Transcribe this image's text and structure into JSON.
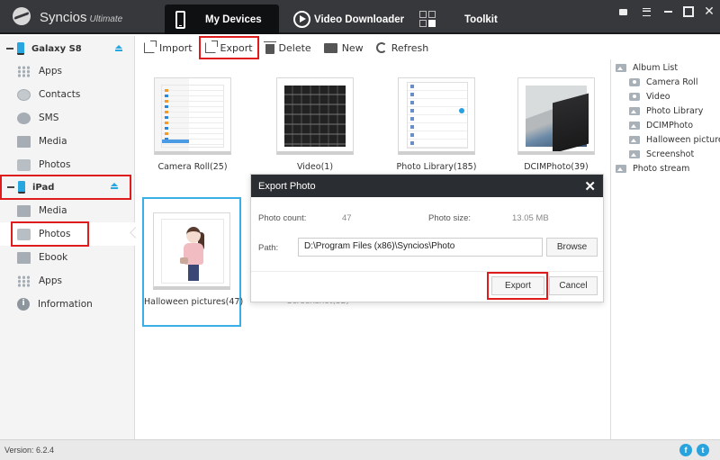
{
  "app": {
    "name": "Syncios",
    "edition": "Ultimate",
    "version": "Version: 6.2.4"
  },
  "nav": {
    "tabs": [
      {
        "label": "My Devices",
        "icon": "phone-icon",
        "active": true
      },
      {
        "label": "Video Downloader",
        "icon": "play-icon",
        "active": false
      },
      {
        "label": "Toolkit",
        "icon": "grid-icon",
        "active": false
      }
    ]
  },
  "window_controls": [
    "feedback-icon",
    "menu-icon",
    "minimize-icon",
    "maximize-icon",
    "close-icon"
  ],
  "window_close_glyph": "✕",
  "sidebar": {
    "devices": [
      {
        "name": "Galaxy S8",
        "items": [
          {
            "label": "Apps",
            "icon": "apps-icon"
          },
          {
            "label": "Contacts",
            "icon": "contacts-icon"
          },
          {
            "label": "SMS",
            "icon": "sms-icon"
          },
          {
            "label": "Media",
            "icon": "media-icon"
          },
          {
            "label": "Photos",
            "icon": "photos-icon"
          }
        ]
      },
      {
        "name": "iPad",
        "highlighted": true,
        "items": [
          {
            "label": "Media",
            "icon": "media-icon"
          },
          {
            "label": "Photos",
            "icon": "photos-icon",
            "selected": true,
            "highlighted": true
          },
          {
            "label": "Ebook",
            "icon": "ebook-icon"
          },
          {
            "label": "Apps",
            "icon": "apps-icon"
          },
          {
            "label": "Information",
            "icon": "info-icon"
          }
        ]
      }
    ],
    "info_glyph": "i"
  },
  "toolbar": {
    "buttons": [
      {
        "label": "Import",
        "icon": "import-icon"
      },
      {
        "label": "Export",
        "icon": "export-icon",
        "highlighted": true
      },
      {
        "label": "Delete",
        "icon": "trash-icon"
      },
      {
        "label": "New",
        "icon": "new-album-icon"
      },
      {
        "label": "Refresh",
        "icon": "refresh-icon"
      }
    ]
  },
  "albums": [
    {
      "label": "Camera Roll(25)"
    },
    {
      "label": "Video(1)"
    },
    {
      "label": "Photo Library(185)"
    },
    {
      "label": "DCIMPhoto(39)"
    },
    {
      "label": "Halloween pictures(47)",
      "selected": true
    },
    {
      "label": "Screenshot(32)",
      "partially_hidden": true
    }
  ],
  "album_list": {
    "title": "Album List",
    "items": [
      {
        "label": "Camera Roll",
        "icon": "camera-icon"
      },
      {
        "label": "Video",
        "icon": "camera-icon"
      },
      {
        "label": "Photo Library",
        "icon": "album-icon"
      },
      {
        "label": "DCIMPhoto",
        "icon": "picture-icon"
      },
      {
        "label": "Halloween pictures",
        "icon": "picture-icon"
      },
      {
        "label": "Screenshot",
        "icon": "album-icon"
      }
    ],
    "photo_stream": "Photo stream"
  },
  "dialog": {
    "title": "Export Photo",
    "close_glyph": "✕",
    "photo_count_label": "Photo count:",
    "photo_count": "47",
    "photo_size_label": "Photo size:",
    "photo_size": "13.05 MB",
    "path_label": "Path:",
    "path_value": "D:\\Program Files (x86)\\Syncios\\Photo",
    "browse_label": "Browse",
    "export_label": "Export",
    "cancel_label": "Cancel"
  },
  "social": {
    "facebook_glyph": "f",
    "twitter_glyph": "t"
  },
  "highlight_color": "#e01b1b",
  "accent_color": "#27a6e0"
}
